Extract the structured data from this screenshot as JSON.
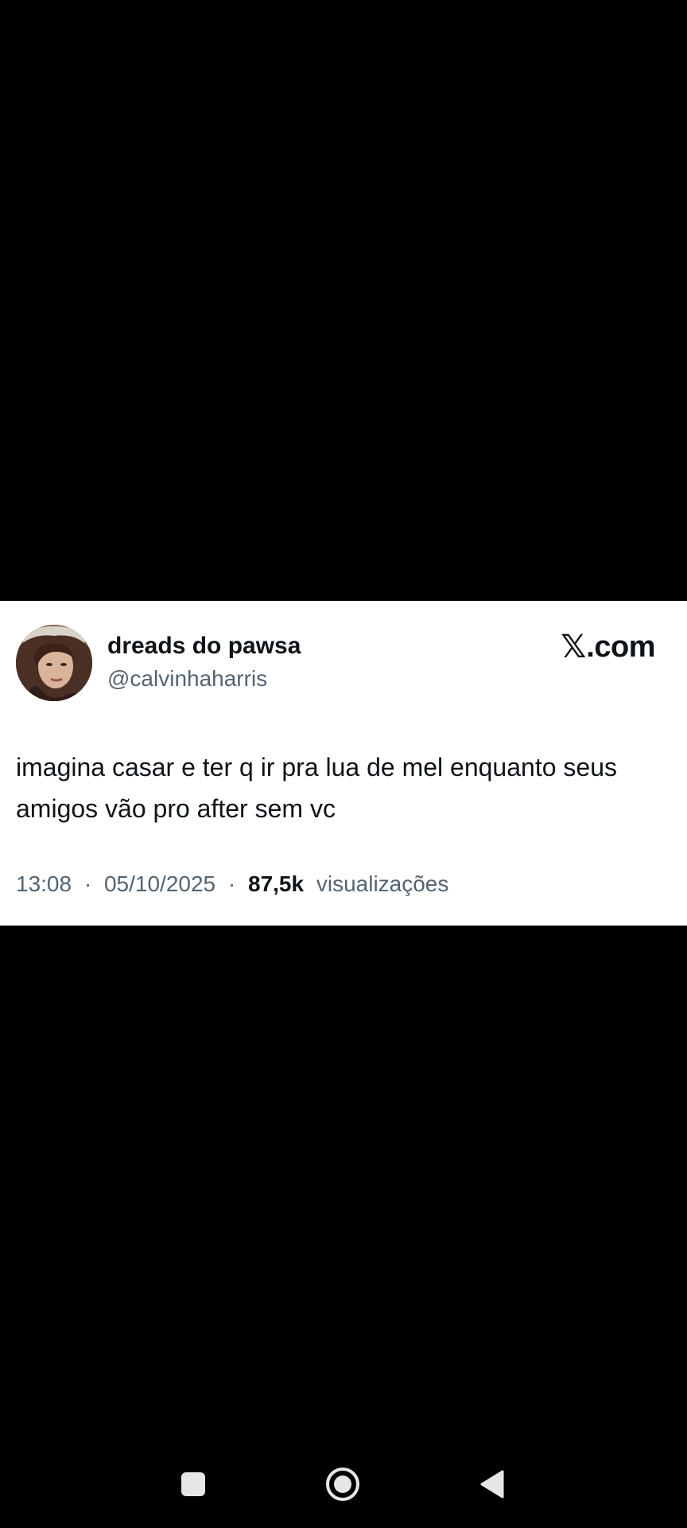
{
  "tweet": {
    "display_name": "dreads do pawsa",
    "handle": "@calvinhaharris",
    "brand_x": "𝕏",
    "brand_domain": ".com",
    "text": "imagina casar e ter q ir pra lua de mel enquanto seus amigos vão pro after sem vc",
    "time": "13:08",
    "separator": "·",
    "date": "05/10/2025",
    "views_count": "87,5k",
    "views_label": "visualizações"
  },
  "navbar": {
    "recents_icon": "square-recents-icon",
    "home_icon": "circle-home-icon",
    "back_icon": "triangle-back-icon"
  },
  "colors": {
    "background": "#000000",
    "card": "#ffffff",
    "primary_text": "#0f1419",
    "secondary_text": "#536471",
    "nav_icon": "#e6e6e6"
  }
}
